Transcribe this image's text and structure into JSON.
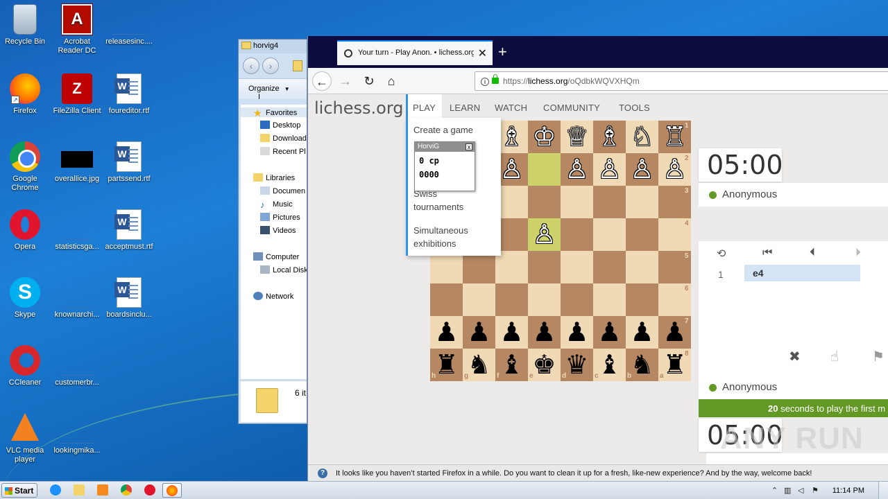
{
  "desktop": {
    "icons": [
      {
        "label": "Recycle Bin"
      },
      {
        "label": "Acrobat Reader DC"
      },
      {
        "label": "releasesinc...."
      },
      {
        "label": "Firefox"
      },
      {
        "label": "FileZilla Client"
      },
      {
        "label": "foureditor.rtf"
      },
      {
        "label": "Google Chrome"
      },
      {
        "label": "overallice.jpg"
      },
      {
        "label": "partssend.rtf"
      },
      {
        "label": "Opera"
      },
      {
        "label": "statisticsga..."
      },
      {
        "label": "acceptmust.rtf"
      },
      {
        "label": "Skype"
      },
      {
        "label": "knownarchi..."
      },
      {
        "label": "boardsinclu..."
      },
      {
        "label": "CCleaner"
      },
      {
        "label": "customerbr..."
      },
      {
        "label": "VLC media player"
      },
      {
        "label": "lookingmika..."
      }
    ]
  },
  "explorer": {
    "title": "horvig4",
    "organize": "Organize",
    "organize_arrow": "▼",
    "toolbar_cut": "I",
    "tree": [
      {
        "label": "Favorites"
      },
      {
        "label": "Desktop"
      },
      {
        "label": "Download"
      },
      {
        "label": "Recent Pl"
      },
      {
        "label": "Libraries"
      },
      {
        "label": "Documen"
      },
      {
        "label": "Music"
      },
      {
        "label": "Pictures"
      },
      {
        "label": "Videos"
      },
      {
        "label": "Computer"
      },
      {
        "label": "Local Disk"
      },
      {
        "label": "Network"
      }
    ],
    "details_text": "6 it"
  },
  "firefox": {
    "tab_title": "Your turn - Play Anon. • lichess.org",
    "tab_close": "✕",
    "new_tab": "+",
    "url_pre": "https://",
    "url_host": "lichess.org",
    "url_path": "/oQdbkWQVXHQm",
    "back": "←",
    "forward": "→",
    "reload": "↻",
    "home": "⌂",
    "notification": "It looks like you haven’t started Firefox in a while. Do you want to clean it up for a fresh, like-new experience? And by the way, welcome back!"
  },
  "lichess": {
    "logo": "lichess.org",
    "nav": [
      "PLAY",
      "LEARN",
      "WATCH",
      "COMMUNITY",
      "TOOLS"
    ],
    "play_menu": [
      "Create a game",
      "Swiss tournaments",
      "Simultaneous exhibitions"
    ],
    "eval_box": {
      "title": "HorviG",
      "close": "x",
      "cp": "0 cp",
      "nodes": "0000"
    },
    "clock_top": "05:00",
    "clock_bottom": "05:00",
    "player_top": "Anonymous",
    "player_bottom": "Anonymous",
    "move_number": "1",
    "move": "e4",
    "controls": [
      "⟲",
      "⏮",
      "⏴",
      "⏵"
    ],
    "actions": [
      "✖",
      "☝",
      "⚑"
    ],
    "timer_seconds": "20",
    "timer_text": "seconds to play the first m",
    "board": {
      "ranks": [
        "1",
        "2",
        "3",
        "4",
        "5",
        "6",
        "7",
        "8"
      ],
      "files_visible": [
        "h",
        "g",
        "f",
        "e",
        "d",
        "c",
        "b",
        "a"
      ],
      "rows": [
        [
          "♖w",
          "♘w",
          "♗w",
          "♔w",
          "♕w",
          "♗w",
          "♘w",
          "♖w"
        ],
        [
          "♙w",
          "♙w",
          "♙w",
          "",
          "♙w",
          "♙w",
          "♙w",
          "♙w"
        ],
        [
          "",
          "",
          "",
          "",
          "",
          "",
          "",
          ""
        ],
        [
          "",
          "",
          "",
          "♙w",
          "",
          "",
          "",
          ""
        ],
        [
          "",
          "",
          "",
          "",
          "",
          "",
          "",
          ""
        ],
        [
          "",
          "",
          "",
          "",
          "",
          "",
          "",
          ""
        ],
        [
          "♟b",
          "♟b",
          "♟b",
          "♟b",
          "♟b",
          "♟b",
          "♟b",
          "♟b"
        ],
        [
          "♜b",
          "♞b",
          "♝b",
          "♚b",
          "♛b",
          "♝b",
          "♞b",
          "♜b"
        ]
      ],
      "highlighted": [
        "1-3",
        "3-3"
      ]
    }
  },
  "watermark": "ANY RUN",
  "taskbar": {
    "start": "Start",
    "time": "11:14 PM"
  }
}
